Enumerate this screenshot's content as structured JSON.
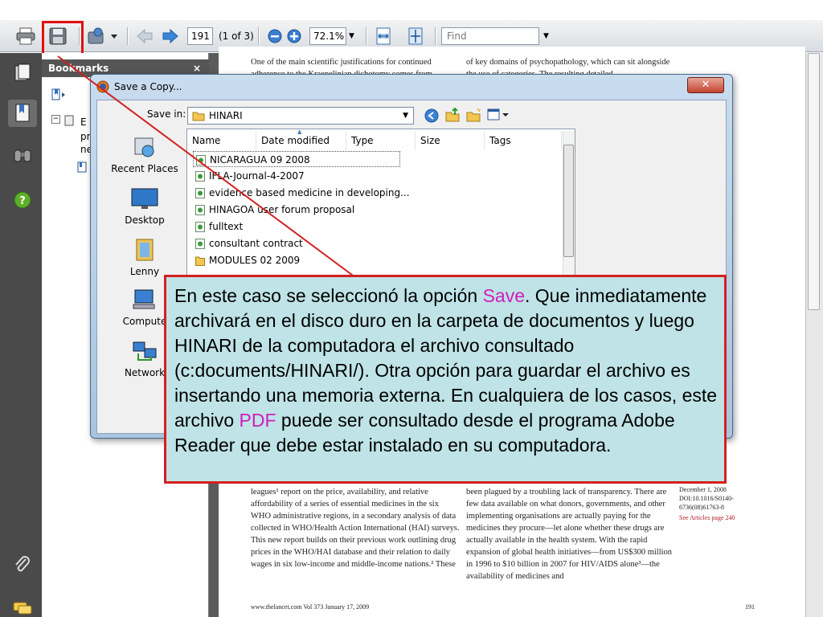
{
  "toolbar": {
    "page_number": "191",
    "page_count": "(1 of 3)",
    "zoom": "72.1%",
    "find_placeholder": "Find"
  },
  "bookmarks": {
    "title": "Bookmarks",
    "close_glyph": "×",
    "item_fragments": [
      "E",
      "pr",
      "ne"
    ]
  },
  "dialog": {
    "title": "Save a Copy...",
    "close_glyph": "✕",
    "save_in_label": "Save in:",
    "save_in_value": "HINARI",
    "places": [
      {
        "label": "Recent Places"
      },
      {
        "label": "Desktop"
      },
      {
        "label": "Lenny"
      },
      {
        "label": "Compute"
      },
      {
        "label": "Network"
      }
    ],
    "columns": [
      "Name",
      "Date modified",
      "Type",
      "Size",
      "Tags"
    ],
    "files": [
      {
        "name": "NICARAGUA 09 2008",
        "kind": "doc"
      },
      {
        "name": "IFLA-Journal-4-2007",
        "kind": "doc"
      },
      {
        "name": "evidence based medicine in developing...",
        "kind": "doc"
      },
      {
        "name": "HINAGOA user forum proposal",
        "kind": "doc"
      },
      {
        "name": "fulltext",
        "kind": "doc"
      },
      {
        "name": "consultant contract",
        "kind": "doc"
      },
      {
        "name": "MODULES 02 2009",
        "kind": "folder"
      }
    ]
  },
  "callout": {
    "part1": "En este caso se seleccionó la opción ",
    "save_word": "Save",
    "part2": ".  Que inmediatamente archivará en el disco duro en la carpeta de documentos y luego HINARI de la computadora el archivo consultado (c:documents/HINARI/).  Otra opción para guardar el archivo es insertando una memoria externa. En cualquiera de los casos, este archivo ",
    "pdf_word": "PDF",
    "part3": " puede ser consultado desde el programa Adobe Reader que debe estar instalado en su computadora."
  },
  "document": {
    "top_left": "One of the main scientific justifications for continued adherence to the Kraepelinian dichotomy comes from",
    "top_right": "of key domains of psychopathology, which can sit alongside the use of categories. The resulting detailed",
    "bottom_left": "leagues¹ report on the price, availability, and relative affordability of a series of essential medicines in the six WHO administrative regions, in a secondary analysis of data collected in WHO/Health Action International (HAI) surveys. This new report builds on their previous work outlining drug prices in the WHO/HAI database and their relation to daily wages in six low-income and middle-income nations.² These",
    "bottom_right": "been plagued by a troubling lack of transparency. There are few data available on what donors, governments, and other implementing organisations are actually paying for the medicines they procure—let alone whether these drugs are actually available in the health system.     With the rapid expansion of global health initiatives—from US$300 million in 1996 to $10 billion in 2007 for HIV/AIDS alone³—the availability of medicines and",
    "margin_note": "December 1, 2008 DOI:10.1016/S0140-6736(08)61763-8",
    "see_articles": "See Articles page 240",
    "footer_left": "www.thelancet.com  Vol 373  January 17, 2009",
    "footer_page": "191"
  },
  "colors": {
    "annotation_red": "#d42020",
    "callout_bg": "#bfe3e6",
    "highlight_magenta": "#d11dbd"
  }
}
